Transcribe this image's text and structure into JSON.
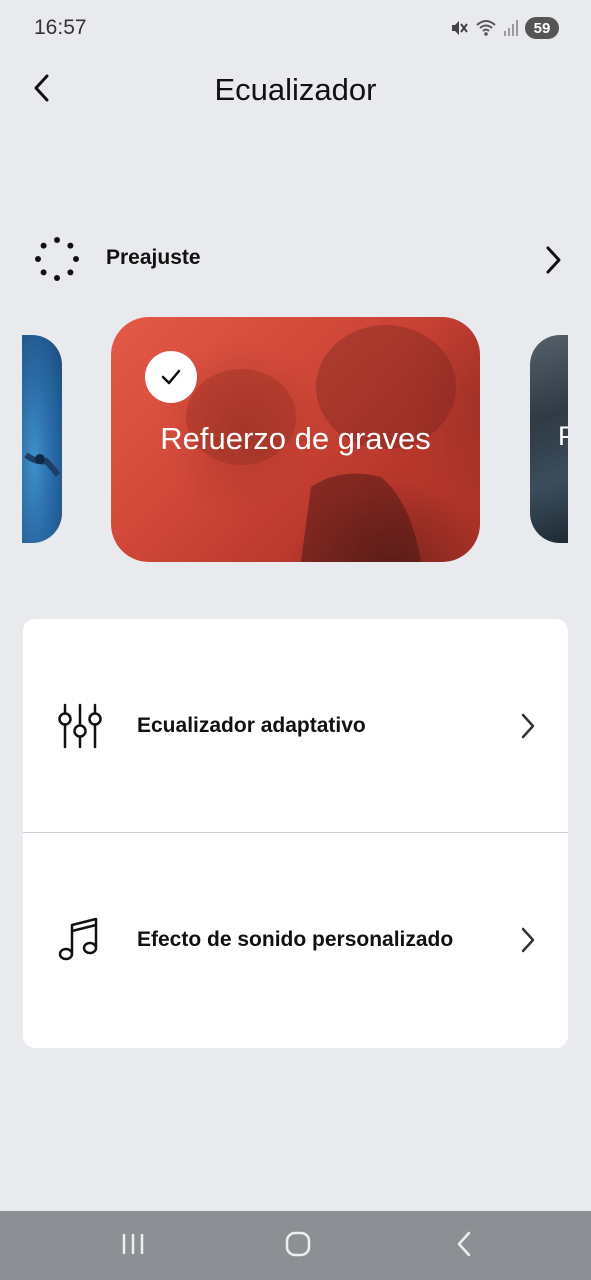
{
  "status_bar": {
    "time": "16:57",
    "battery": "59",
    "icons": [
      "mute-icon",
      "wifi-icon",
      "signal-icon",
      "battery-icon"
    ]
  },
  "header": {
    "title": "Ecualizador",
    "back_icon": "chevron-left-icon"
  },
  "preset": {
    "label": "Preajuste",
    "icon": "dots-circle-icon",
    "chevron": "chevron-right-icon"
  },
  "carousel": {
    "selected_card_title": "Refuerzo de graves",
    "selected": true,
    "right_peek_text": "P",
    "colors": {
      "selected_card": "#d44a3a"
    }
  },
  "options": [
    {
      "label": "Ecualizador adaptativo",
      "icon": "equalizer-sliders-icon"
    },
    {
      "label": "Efecto de sonido personalizado",
      "icon": "music-note-icon"
    }
  ],
  "nav_bar": {
    "buttons": [
      "recents-icon",
      "home-icon",
      "back-icon"
    ]
  }
}
